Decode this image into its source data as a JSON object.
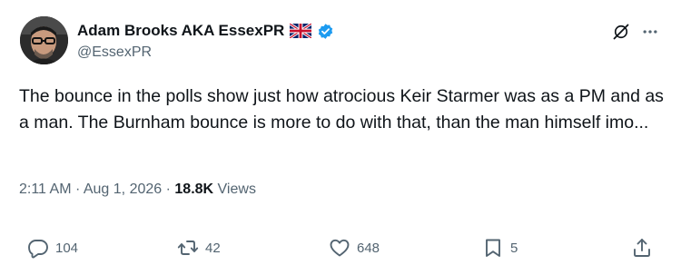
{
  "user": {
    "display_name": "Adam Brooks AKA EssexPR",
    "handle": "@EssexPR"
  },
  "tweet": {
    "text": "The bounce in the polls show just how atrocious Keir Starmer was as a PM and as a man. The Burnham bounce is more to do with that, than the man himself imo..."
  },
  "meta": {
    "time": "2:11 AM",
    "separator": "·",
    "date": "Aug 1, 2026",
    "views_count": "18.8K",
    "views_label": "Views"
  },
  "actions": {
    "replies": "104",
    "reposts": "42",
    "likes": "648",
    "bookmarks": "5"
  },
  "icons": {
    "flag": "uk-flag-icon",
    "verified": "verified-badge-icon",
    "grok": "grok-icon",
    "more": "more-icon",
    "reply": "reply-icon",
    "retweet": "retweet-icon",
    "like": "heart-icon",
    "bookmark": "bookmark-icon",
    "share": "share-icon"
  },
  "colors": {
    "text_primary": "#0f1419",
    "text_secondary": "#536471",
    "verified_blue": "#1d9bf0"
  }
}
